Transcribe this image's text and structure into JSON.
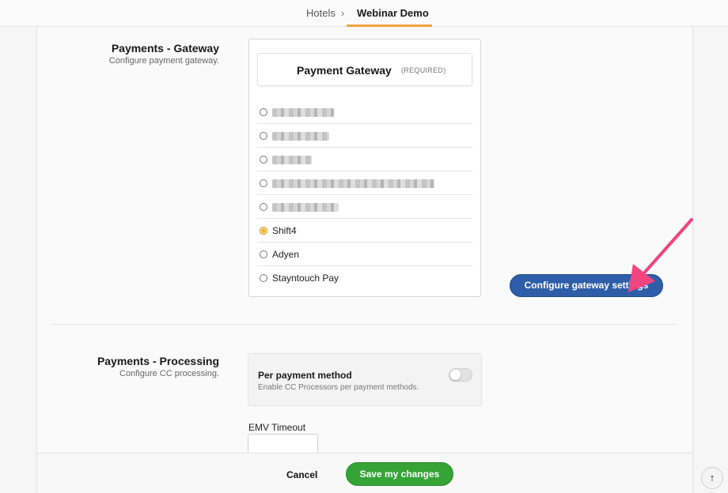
{
  "breadcrumb": {
    "parent": "Hotels",
    "separator": "›",
    "current": "Webinar Demo"
  },
  "gateway_section": {
    "title": "Payments - Gateway",
    "description": "Configure payment gateway.",
    "card_title": "Payment Gateway",
    "required_tag": "(REQUIRED)",
    "options": [
      {
        "label": "",
        "redacted": true,
        "selected": false
      },
      {
        "label": "",
        "redacted": true,
        "selected": false
      },
      {
        "label": "",
        "redacted": true,
        "selected": false
      },
      {
        "label": "",
        "redacted": true,
        "selected": false
      },
      {
        "label": "",
        "redacted": true,
        "selected": false
      },
      {
        "label": "Shift4",
        "redacted": false,
        "selected": true
      },
      {
        "label": "Adyen",
        "redacted": false,
        "selected": false
      },
      {
        "label": "Stayntouch Pay",
        "redacted": false,
        "selected": false
      }
    ],
    "configure_button": "Configure gateway settings"
  },
  "processing_section": {
    "title": "Payments - Processing",
    "description": "Configure CC processing.",
    "per_payment_title": "Per payment method",
    "per_payment_desc": "Enable CC Processors per payment methods.",
    "toggle_on": false,
    "emv_label": "EMV Timeout",
    "emv_value": ""
  },
  "footer": {
    "cancel": "Cancel",
    "save": "Save my changes"
  },
  "scroll_top_icon": "↑",
  "colors": {
    "accent_orange": "#f0a540",
    "button_blue": "#2f5ea8",
    "save_green": "#35a336",
    "annotation_pink": "#f0457f",
    "radio_selected": "#f2b41c"
  },
  "icons": {
    "annotation": "arrow-annotation-icon",
    "scroll_top": "arrow-up-icon"
  }
}
